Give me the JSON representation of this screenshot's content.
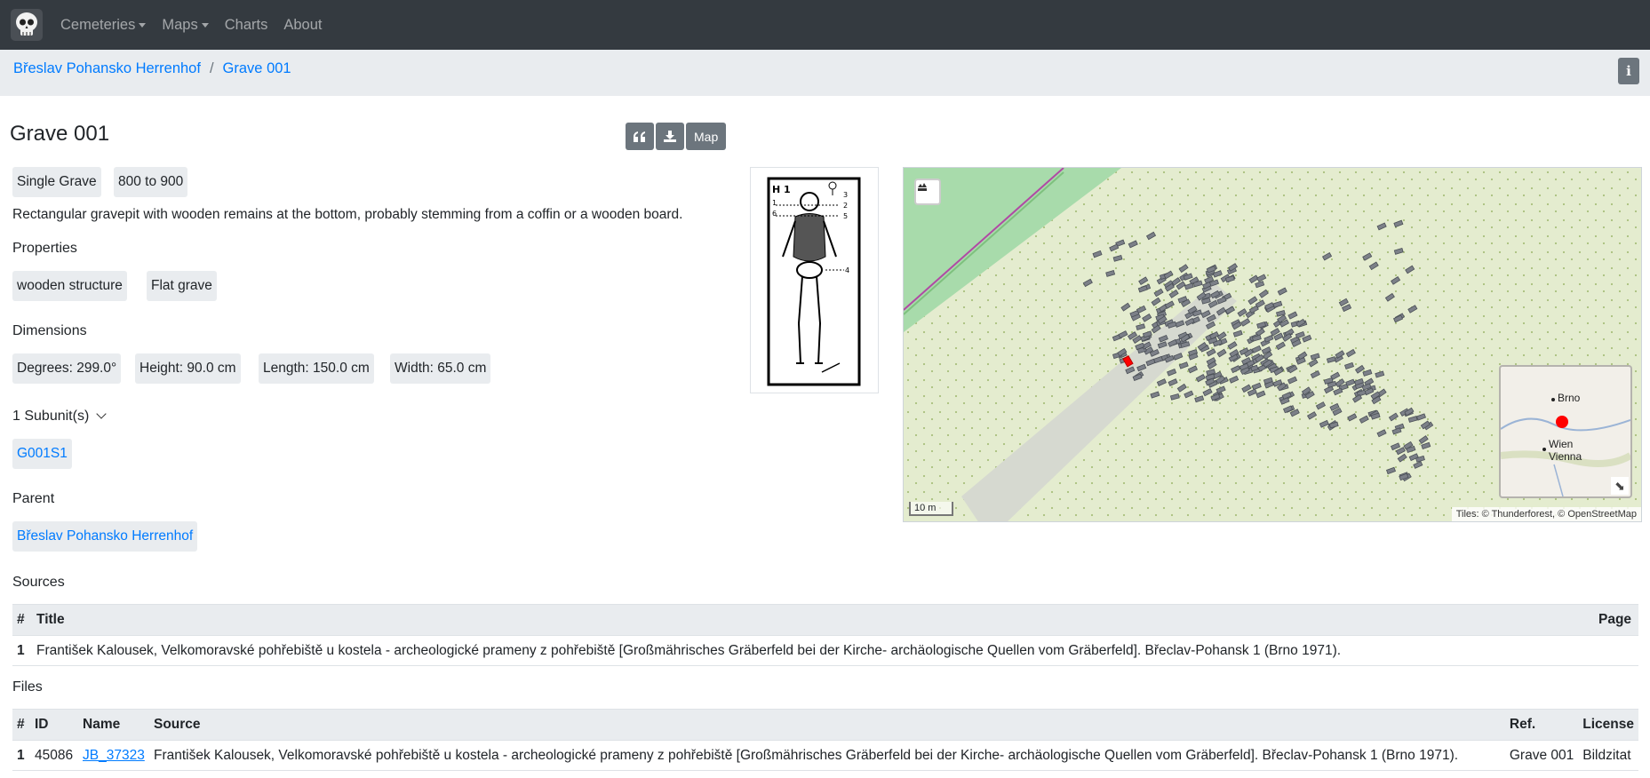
{
  "nav": {
    "items": [
      {
        "label": "Cemeteries",
        "dropdown": true
      },
      {
        "label": "Maps",
        "dropdown": true
      },
      {
        "label": "Charts",
        "dropdown": false
      },
      {
        "label": "About",
        "dropdown": false
      }
    ]
  },
  "breadcrumb": [
    "Břeslav Pohansko Herrenhof",
    "Grave 001"
  ],
  "title": "Grave 001",
  "buttons": {
    "map_label": "Map",
    "cite_icon": "quote-icon",
    "download_icon": "download-icon"
  },
  "tags": [
    "Single Grave",
    "800 to 900"
  ],
  "description": "Rectangular gravepit with wooden remains at the bottom, probably stemming from a coffin or a wooden board.",
  "properties": {
    "label": "Properties",
    "items": [
      "wooden structure",
      "Flat grave"
    ]
  },
  "dimensions": {
    "label": "Dimensions",
    "items": [
      "Degrees: 299.0°",
      "Height: 90.0 cm",
      "Length: 150.0 cm",
      "Width: 65.0 cm"
    ]
  },
  "subunits": {
    "label": "1 Subunit(s)",
    "items": [
      "G001S1"
    ]
  },
  "parent": {
    "label": "Parent",
    "value": "Břeslav Pohansko Herrenhof"
  },
  "sources": {
    "label": "Sources",
    "columns": [
      "#",
      "Title",
      "Page"
    ],
    "rows": [
      {
        "num": "1",
        "title": "František Kalousek, Velkomoravské pohřebiště u kostela - archeologické prameny z pohřebiště [Großmährisches Gräberfeld bei der Kirche- archäologische Quellen vom Gräberfeld]. Břeclav-Pohansk 1 (Brno 1971).",
        "page": ""
      }
    ]
  },
  "files": {
    "label": "Files",
    "columns": [
      "#",
      "ID",
      "Name",
      "Source",
      "Ref.",
      "License"
    ],
    "rows": [
      {
        "num": "1",
        "id": "45086",
        "name": "JB_37323",
        "source": "František Kalousek, Velkomoravské pohřebiště u kostela - archeologické prameny z pohřebiště [Großmährisches Gräberfeld bei der Kirche- archäologische Quellen vom Gräberfeld]. Břeclav-Pohansk 1 (Brno 1971).",
        "ref": "Grave 001",
        "license": "Bildzitat"
      }
    ]
  },
  "map": {
    "scale": "10 m",
    "attribution": "Tiles: © Thunderforest, © OpenStreetMap",
    "minimap_labels": {
      "brno": "Brno",
      "wien": "Wien",
      "vienna": "Vienna"
    },
    "highlight_color": "#ff0000"
  },
  "sketch_labels": {
    "id": "H 1"
  }
}
